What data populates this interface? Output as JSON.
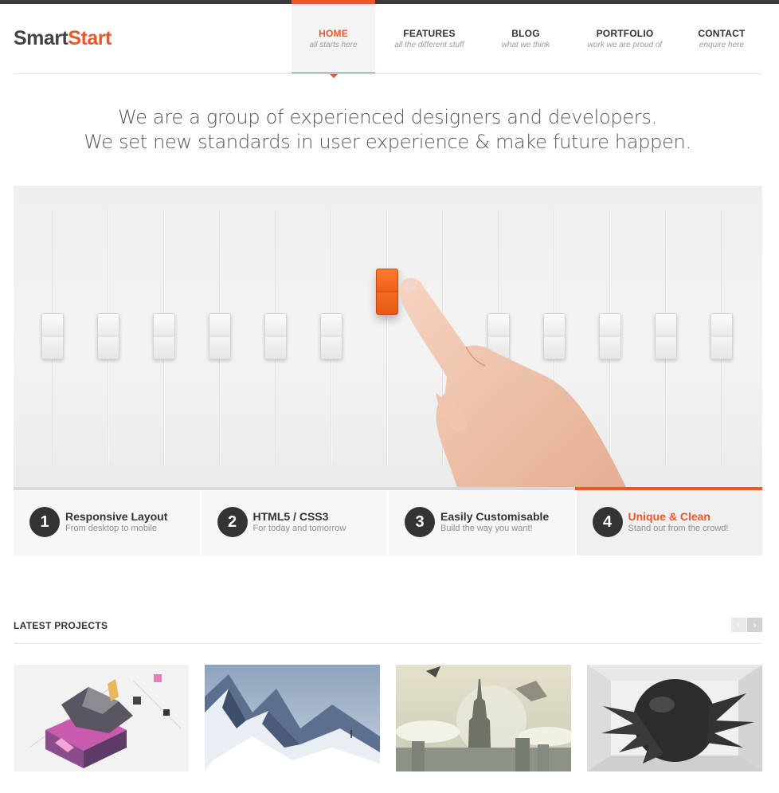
{
  "brand": {
    "part1": "Smart",
    "part2": "Start",
    "accent_color": "#e8582b"
  },
  "nav": [
    {
      "label": "HOME",
      "sub": "all starts here",
      "active": true
    },
    {
      "label": "FEATURES",
      "sub": "all the different stuff",
      "active": false
    },
    {
      "label": "BLOG",
      "sub": "what we think",
      "active": false
    },
    {
      "label": "PORTFOLIO",
      "sub": "work we are proud of",
      "active": false
    },
    {
      "label": "CONTACT",
      "sub": "enquire here",
      "active": false
    }
  ],
  "tagline": {
    "line1": "We are a group of experienced designers and developers.",
    "line2": "We set new standards in user experience & make future happen."
  },
  "slider": {
    "image_subject": "mixer-faders-hand-icon",
    "active_slide": 4
  },
  "features": [
    {
      "num": "1",
      "title": "Responsive Layout",
      "sub": "From desktop to mobile",
      "active": false
    },
    {
      "num": "2",
      "title": "HTML5 / CSS3",
      "sub": "For today and tomorrow",
      "active": false
    },
    {
      "num": "3",
      "title": "Easily Customisable",
      "sub": "Build the way you want!",
      "active": false
    },
    {
      "num": "4",
      "title": "Unique & Clean",
      "sub": "Stand out from the crowd!",
      "active": true
    }
  ],
  "latest": {
    "title": "LATEST PROJECTS",
    "prev_icon": "chevron-left-icon",
    "next_icon": "chevron-right-icon"
  },
  "projects": [
    {
      "thumb": "isometric-cube-art"
    },
    {
      "thumb": "snowy-mountain-art"
    },
    {
      "thumb": "city-tower-art"
    },
    {
      "thumb": "dark-sphere-art"
    }
  ]
}
